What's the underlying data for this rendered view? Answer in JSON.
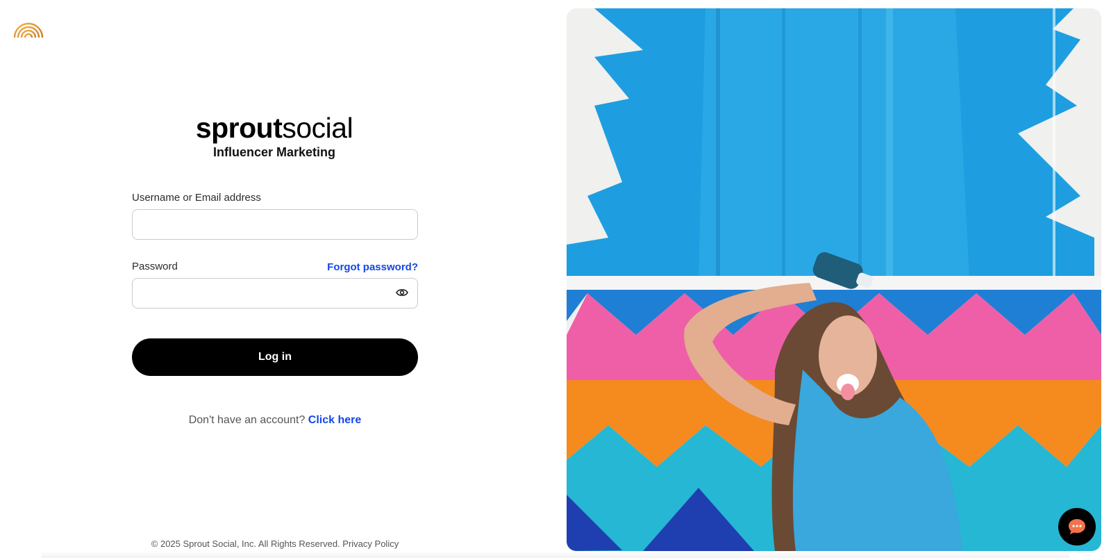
{
  "brand": {
    "word_bold": "sprout",
    "word_light": "social",
    "subtitle": "Influencer Marketing"
  },
  "form": {
    "username_label": "Username or Email address",
    "username_value": "",
    "password_label": "Password",
    "password_value": "",
    "forgot_password": "Forgot password?",
    "login_button": "Log in"
  },
  "signup": {
    "prompt": "Don't have an account?",
    "link": "Click here"
  },
  "footer": {
    "copyright": "© 2025 Sprout Social, Inc. All Rights Reserved.",
    "privacy": "Privacy Policy"
  },
  "icons": {
    "corner_logo": "rainbow-logo-icon",
    "password_toggle": "eye-icon",
    "chat": "chat-bubble-icon"
  },
  "colors": {
    "link": "#1447e6",
    "button": "#000000",
    "logo_gradient_start": "#f2a33a",
    "logo_gradient_end": "#c8872c"
  }
}
